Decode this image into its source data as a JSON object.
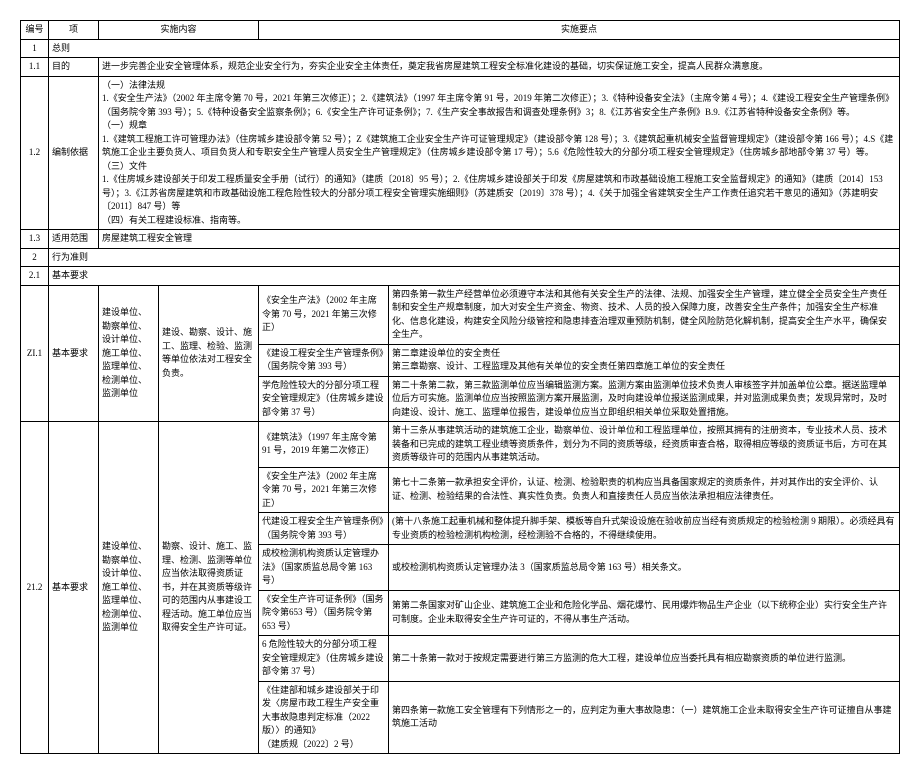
{
  "header": {
    "c0": "编号",
    "c1": "项",
    "c2": "实施内容",
    "c3": "实施要点"
  },
  "rows": {
    "r1": {
      "num": "1",
      "item": "总则"
    },
    "r11": {
      "num": "1.1",
      "item": "目的",
      "content": "进一步完善企业安全管理体系，规范企业安全行为，夯实企业安全主体责任，奠定我省房屋建筑工程安全标准化建设的基础，切实保证施工安全，提高人民群众满意度。"
    },
    "r12": {
      "num": "1.2",
      "item": "编制依据",
      "content": "（一）法律法规\n1.《安全生产法》（2002 年主席令第 70 号，2021 年第三次修正）；2.《建筑法》（1997 年主席令第 91 号，2019 年第二次修正）；3.《特种设备安全法》（主席令第 4 号）；4.《建设工程安全生产管理条例》（国务院令第 393 号）；5.《特种设备安全监察条例》；6.《安全生产许可证条例》；7.《生产安全事故报告和调查处理条例》3；8.《江苏省安全生产条例》B.9.《江苏省特种设备安全条例》等。\n（一）规章\n1.《建筑工程施工许可管理办法》（住房城乡建设部令第 52 号）；Z《建筑施工企业安全生产许可证管理规定》（建设部令第 128 号）；3.《建筑起重机械安全监督管理规定》（建设部令第 166 号）；4.S《建筑施工企业主要负货人、项目负货人和专职安全生产管理人员安全生产管理规定》（住房城乡建设部令第 17 号）；5.6《危险性较大的分部分项工程安全管理规定》（住房城乡部地部令第 37 号）等。\n（三）文件\n1.《住房城乡建设部关于印发工程质量安全手册（试行）的通知》（建质〔2018〕95 号）；2.《住房城乡建设部关于印发《房屋建筑和市政基础设施工程施工安全监督规定》的通知》（建质〔2014〕153 号）；3.《江苏省房屋建筑和市政基础设施工程危险性较大的分部分项工程安全管理实施细则》（苏建质安〔2019〕378 号）；4.《关于加强全省建筑安全生产工作责任追究若干意见的通知》（苏建明安〔2011〕847 号）等\n（四）有关工程建设标准、指南等。"
    },
    "r13": {
      "num": "1.3",
      "item": "适用范围",
      "content": "房屋建筑工程安全管理"
    },
    "r2": {
      "num": "2",
      "item": "行为准则"
    },
    "r21": {
      "num": "2.1",
      "item": "基本要求"
    },
    "ZI1": {
      "num": "ZI.1",
      "item": "基本要求",
      "c1": "建设单位、勘察单位、设计单位、施工单位、监理单位、检测单位、监测单位",
      "c2": "建设、勘察、设计、施工、监理、检验、监测等单位依法对工程安全负责。",
      "sub": [
        {
          "c3": "《安全生产法》（2002 年主席令第 70 号，2021 年第三次修正）",
          "c4": "第四条第一款生产经营单位必须遵守本法和其他有关安全生产的法律、法规、加强安全生产管理，建立健全全员安全生产责任制和安全生产规章制度，加大对安全生产资金、物资、技术、人员的投入保障力度，改善安全生产条件；加强安全生产标准化、信息化建设，构建安全风险分级管控和隐患排查治理双重预防机制，健全风险防范化解机制，提高安全生产水平，确保安全生产。"
        },
        {
          "c3": "《建设工程安全生产管理条例》（国务院令第 393 号）",
          "c4": "第二章建设单位的安全责任\n第三章勘察、设计、工程监理及其他有关单位的安全责任第四章施工单位的安全责任"
        },
        {
          "c3": "学危险性较大的分部分项工程安全管理规定》（住房城乡建设部令第 37 号）",
          "c4": "第二十条第二款，第三款监测单位应当编辑监测方案。监测方案由监测单位技术负责人审核签字并加盖单位公章。据送监理单位后方可实施。监测单位应当按照监测方案开展监测，及时向建设单位报送监测成果，并对监测成果负责；发现异常时，及时向建设、设计、施工、监理单位报告，建设单位应当立即组织相关单位采取处置措施。"
        }
      ]
    },
    "r212": {
      "num": "21.2",
      "item": "基本要求",
      "c1": "建设单位、勘察单位、设计单位、施工单位、监理单位、检测单位、监测单位",
      "c2": "勘察、设计、施工、监理、检测、监测等单位应当依法取得资质证书，并在其资质等级许可的范围内从事建设工程活动。施工单位应当取得安全生产许可证。",
      "sub": [
        {
          "c3": "《建筑法》（1997 年主席令第 91 号，2019 年第二次修正）",
          "c4": "第十三条从事建筑活动的建筑施工企业，勘察单位、设计单位和工程监理单位，按照其拥有的注册资本，专业技术人员、技术装备和已完成的建筑工程业绩等资质条件，划分为不同的资质等级，经资质审查合格，取得相应等级的资质证书后，方可在其资质等级许可的范围内从事建筑活动。"
        },
        {
          "c3": "《安全生产法》（2002 年主席令第 70 号，2021 年第三次修正）",
          "c4": "第七十二条第一款承担安全评价，认证、检测、检验职责的机构应当具备国家规定的资质条件，并对其作出的安全评价、认证、检测、检验结果的合法性、真实性负责。负责人和直接责任人员应当依法承担相应法律责任。"
        },
        {
          "c3": "代建设工程安全生产管理条例》（国务院令第 393 号）",
          "c4": "(第十八条施工起重机械和整体提升脚手架、模板等自升式架设设施在验收前应当经有资质规定的检验检测 9 期限）。必须经具有专业资质的检验检测机构检测，经检测验不合格的，不得继续使用。"
        },
        {
          "c3": "成校检测机构资质认定管理办法》（国家质监总局令第 163 号）",
          "c4": "或校检测机构资质认定管理办法 3（国家质监总局令第 163 号）相关条文。"
        },
        {
          "c3": "《安全生产许可证条例》（国务院令第653 号）（国务院令第 653 号）",
          "c4": "第第二条国家对矿山企业、建筑施工企业和危险化学品、烟花爆竹、民用爆炸物品生产企业（以下统称企业）实行安全生产许可制度。企业未取得安全生产许可证的，不得从事生产活动。"
        },
        {
          "c3": "6 危险性较大的分部分项工程安全管理规定》（住房城乡建设部令第 37 号）",
          "c4": "第二十条第一款对于按规定需要进行第三方监测的危大工程，建设单位应当委托具有相应勘察资质的单位进行监测。"
        },
        {
          "c3": "《住建部和城乡建设部关于印发〈房屋市政工程生产安全重大事故隐患判定标准（2022 版）〉的通知》\n（建质规〔2022〕2 号）",
          "c4": "第四条第一款施工安全管理有下列情形之一的，应判定为重大事故隐患：（一）建筑施工企业未取得安全生产许可证擅自从事建筑施工活动"
        }
      ]
    }
  }
}
